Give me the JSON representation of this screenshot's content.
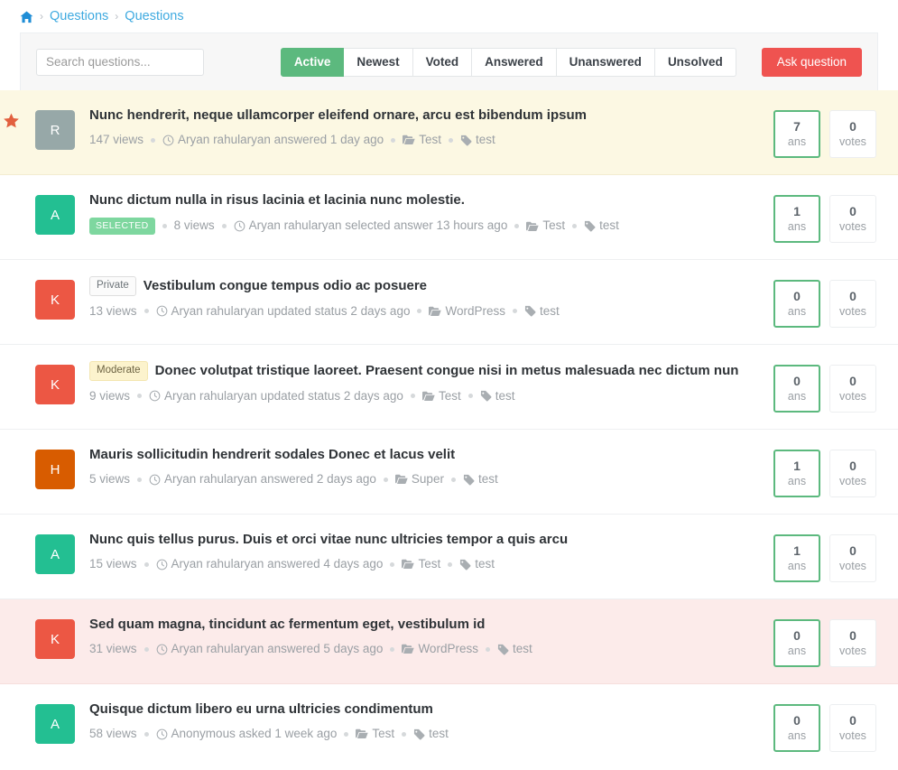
{
  "breadcrumb": {
    "home_icon": "home-icon",
    "separator": "›",
    "items": [
      "Questions",
      "Questions"
    ]
  },
  "toolbar": {
    "search": {
      "placeholder": "Search questions...",
      "value": ""
    },
    "filters": [
      {
        "label": "Active",
        "active": true
      },
      {
        "label": "Newest",
        "active": false
      },
      {
        "label": "Voted",
        "active": false
      },
      {
        "label": "Answered",
        "active": false
      },
      {
        "label": "Unanswered",
        "active": false
      },
      {
        "label": "Unsolved",
        "active": false
      }
    ],
    "ask_label": "Ask question"
  },
  "colors": {
    "accent_green": "#5cb97e",
    "accent_red": "#ef5350",
    "link_blue": "#3faae0",
    "highlight_yellow": "#fcf8e3",
    "highlight_pink": "#fcebea",
    "star_orange": "#e2603f"
  },
  "labels": {
    "ans": "ans",
    "votes": "votes"
  },
  "questions": [
    {
      "avatar_letter": "R",
      "avatar_color": "#97a8a8",
      "title": "Nunc hendrerit, neque ullamcorper eleifend ornare, arcu est bibendum ipsum",
      "badge": null,
      "starred": true,
      "highlight": "yellow",
      "views": "147 views",
      "activity": "Aryan rahularyan answered 1 day ago",
      "category": "Test",
      "tag": "test",
      "answers": "7",
      "votes": "0"
    },
    {
      "avatar_letter": "A",
      "avatar_color": "#23bf92",
      "title": "Nunc dictum nulla in risus lacinia et lacinia nunc molestie.",
      "badge": {
        "text": "SELECTED",
        "type": "selected",
        "position": "meta"
      },
      "starred": false,
      "highlight": "none",
      "views": "8 views",
      "activity": "Aryan rahularyan selected answer 13 hours ago",
      "category": "Test",
      "tag": "test",
      "answers": "1",
      "votes": "0"
    },
    {
      "avatar_letter": "K",
      "avatar_color": "#ec5744",
      "title": "Vestibulum congue tempus odio ac posuere",
      "badge": {
        "text": "Private",
        "type": "private",
        "position": "title"
      },
      "starred": false,
      "highlight": "none",
      "views": "13 views",
      "activity": "Aryan rahularyan updated status 2 days ago",
      "category": "WordPress",
      "tag": "test",
      "answers": "0",
      "votes": "0"
    },
    {
      "avatar_letter": "K",
      "avatar_color": "#ec5744",
      "title": "Donec volutpat tristique laoreet. Praesent congue nisi in metus malesuada nec dictum nun",
      "badge": {
        "text": "Moderate",
        "type": "moderate",
        "position": "title"
      },
      "starred": false,
      "highlight": "none",
      "views": "9 views",
      "activity": "Aryan rahularyan updated status 2 days ago",
      "category": "Test",
      "tag": "test",
      "answers": "0",
      "votes": "0"
    },
    {
      "avatar_letter": "H",
      "avatar_color": "#d85c00",
      "title": "Mauris sollicitudin hendrerit sodales Donec et lacus velit",
      "badge": null,
      "starred": false,
      "highlight": "none",
      "views": "5 views",
      "activity": "Aryan rahularyan answered 2 days ago",
      "category": "Super",
      "tag": "test",
      "answers": "1",
      "votes": "0"
    },
    {
      "avatar_letter": "A",
      "avatar_color": "#23bf92",
      "title": "Nunc quis tellus purus. Duis et orci vitae nunc ultricies tempor a quis arcu",
      "badge": null,
      "starred": false,
      "highlight": "none",
      "views": "15 views",
      "activity": "Aryan rahularyan answered 4 days ago",
      "category": "Test",
      "tag": "test",
      "answers": "1",
      "votes": "0"
    },
    {
      "avatar_letter": "K",
      "avatar_color": "#ec5744",
      "title": "Sed quam magna, tincidunt ac fermentum eget, vestibulum id",
      "badge": null,
      "starred": false,
      "highlight": "pink",
      "views": "31 views",
      "activity": "Aryan rahularyan answered 5 days ago",
      "category": "WordPress",
      "tag": "test",
      "answers": "0",
      "votes": "0"
    },
    {
      "avatar_letter": "A",
      "avatar_color": "#23bf92",
      "title": "Quisque dictum libero eu urna ultricies condimentum",
      "badge": null,
      "starred": false,
      "highlight": "none",
      "views": "58 views",
      "activity": "Anonymous asked 1 week ago",
      "category": "Test",
      "tag": "test",
      "answers": "0",
      "votes": "0"
    }
  ]
}
